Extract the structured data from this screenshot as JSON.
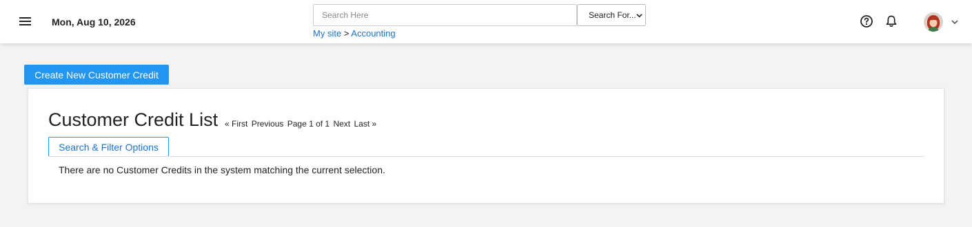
{
  "header": {
    "date": "Mon, Aug 10, 2026",
    "search": {
      "placeholder": "Search Here",
      "value": ""
    },
    "search_for": {
      "selected": "Search For..."
    },
    "breadcrumb": {
      "home": "My site",
      "separator": ">",
      "current": "Accounting"
    },
    "icons": [
      "menu-icon",
      "help-icon",
      "bell-icon",
      "avatar",
      "chevron-down-icon"
    ]
  },
  "actions": {
    "create_label": "Create New Customer Credit"
  },
  "list": {
    "title": "Customer Credit List",
    "pager": {
      "first": "« First",
      "previous": "Previous",
      "page_info": "Page 1 of 1",
      "next": "Next",
      "last": "Last »"
    },
    "filter_label": "Search & Filter Options",
    "empty_message": "There are no Customer Credits in the system matching the current selection."
  },
  "colors": {
    "accent": "#2196f3",
    "link": "#1a73c8",
    "background": "#f3f3f3"
  }
}
